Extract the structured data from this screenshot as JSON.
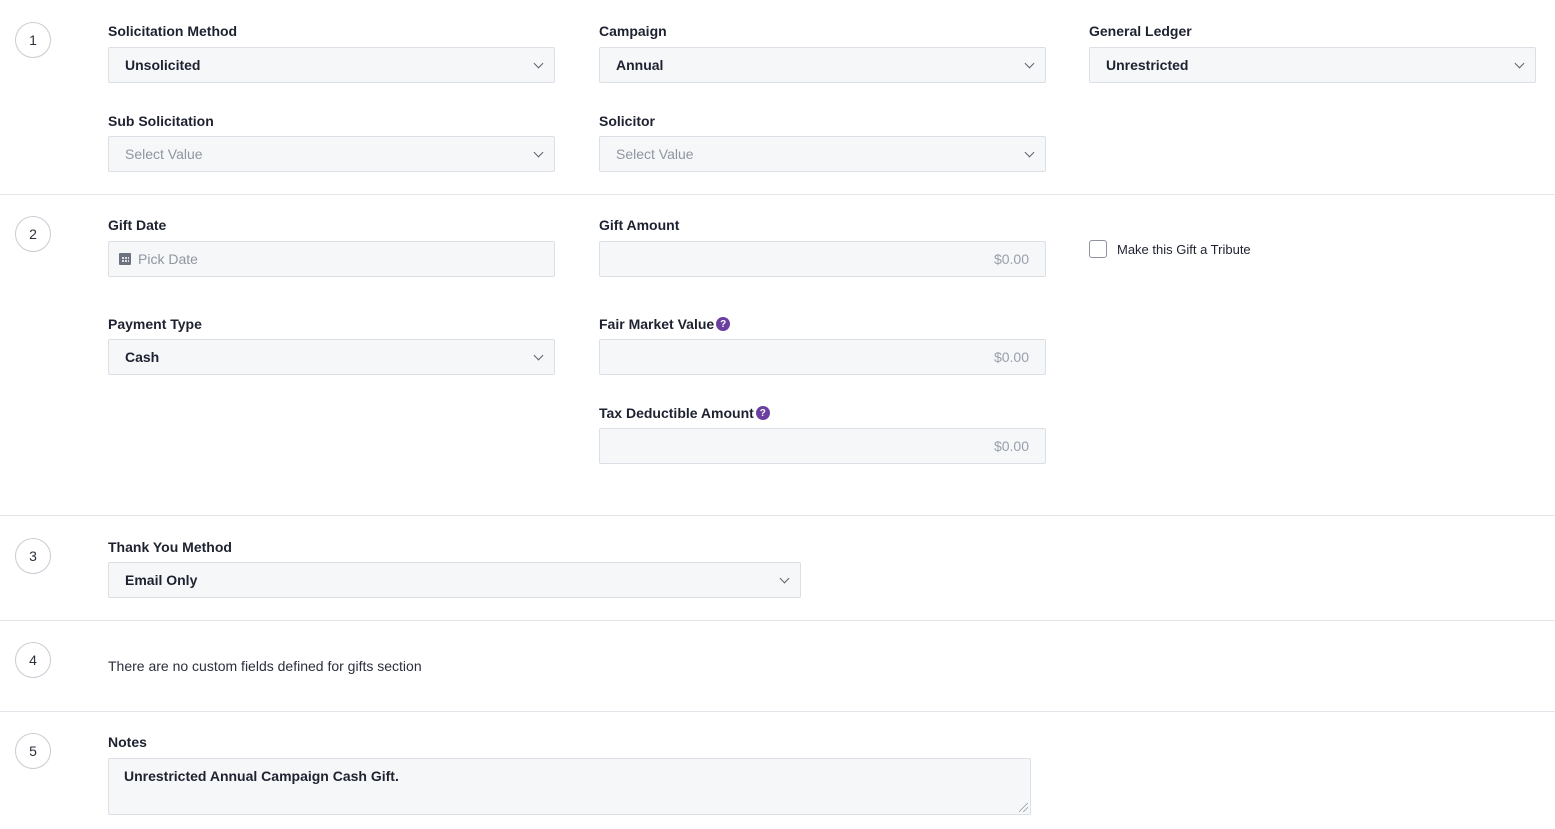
{
  "sections": [
    {
      "step": "1"
    },
    {
      "step": "2"
    },
    {
      "step": "3"
    },
    {
      "step": "4"
    },
    {
      "step": "5"
    }
  ],
  "s1": {
    "solicitation_method": {
      "label": "Solicitation Method",
      "value": "Unsolicited"
    },
    "campaign": {
      "label": "Campaign",
      "value": "Annual"
    },
    "general_ledger": {
      "label": "General Ledger",
      "value": "Unrestricted"
    },
    "sub_solicitation": {
      "label": "Sub Solicitation",
      "placeholder": "Select Value"
    },
    "solicitor": {
      "label": "Solicitor",
      "placeholder": "Select Value"
    }
  },
  "s2": {
    "gift_date": {
      "label": "Gift Date",
      "placeholder": "Pick Date",
      "icon": "calendar-icon"
    },
    "gift_amount": {
      "label": "Gift Amount",
      "placeholder": "$0.00"
    },
    "tribute": {
      "label": "Make this Gift a Tribute",
      "checked": false
    },
    "payment_type": {
      "label": "Payment Type",
      "value": "Cash"
    },
    "fair_market_value": {
      "label": "Fair Market Value",
      "placeholder": "$0.00",
      "help": "?"
    },
    "tax_deductible": {
      "label": "Tax Deductible Amount",
      "placeholder": "$0.00",
      "help": "?"
    }
  },
  "s3": {
    "thank_you_method": {
      "label": "Thank You Method",
      "value": "Email Only"
    }
  },
  "s4": {
    "message": "There are no custom fields defined for gifts section"
  },
  "s5": {
    "notes": {
      "label": "Notes",
      "value": "Unrestricted Annual Campaign Cash Gift."
    }
  },
  "colors": {
    "help_badge": "#6b3fa0",
    "field_bg": "#f6f7f9",
    "border": "#dcdfe5"
  }
}
